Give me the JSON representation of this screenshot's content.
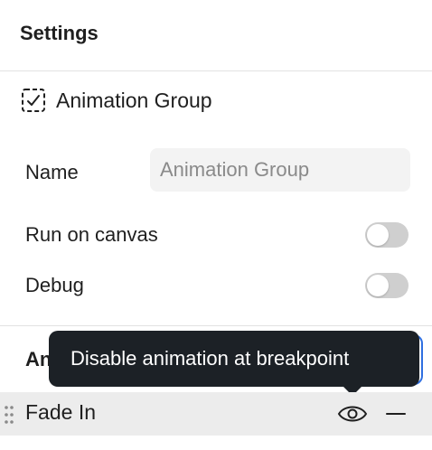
{
  "header": {
    "title": "Settings"
  },
  "group": {
    "title": "Animation Group",
    "icon": "animation-group-icon"
  },
  "fields": {
    "name_label": "Name",
    "name_placeholder": "Animation Group",
    "run_on_canvas_label": "Run on canvas",
    "run_on_canvas_enabled": false,
    "debug_label": "Debug",
    "debug_enabled": false
  },
  "animations": {
    "section_label": "An",
    "tooltip": "Disable animation at breakpoint",
    "items": [
      {
        "name": "Fade In",
        "visibility_icon": "eye-icon",
        "remove_icon": "minus-icon"
      }
    ]
  },
  "colors": {
    "accent": "#2f6fe0",
    "tooltip_bg": "#1c2126",
    "toggle_off": "#cfcfcf",
    "row_bg": "#ececec"
  }
}
